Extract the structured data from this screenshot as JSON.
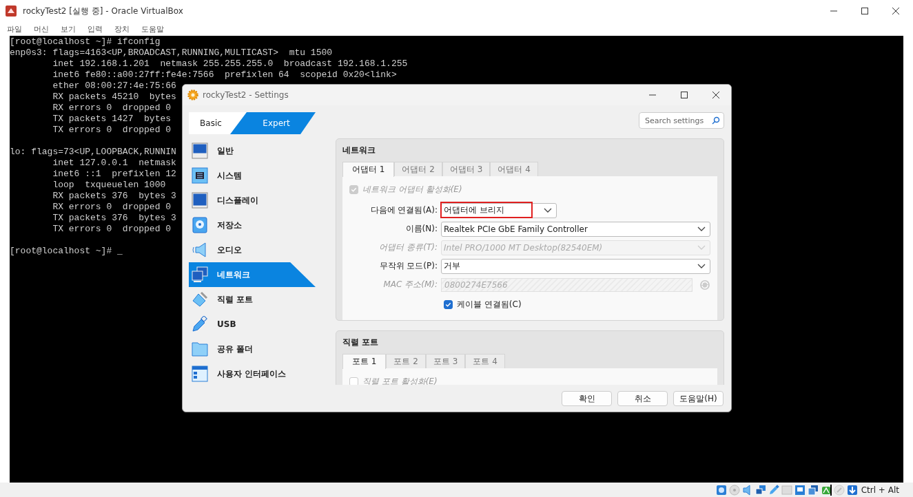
{
  "window": {
    "title": "rockyTest2 [실행 중] - Oracle VirtualBox"
  },
  "menu": [
    "파일",
    "머신",
    "보기",
    "입력",
    "장치",
    "도움말"
  ],
  "terminal": {
    "blocks": [
      [
        "[root@localhost ~]# ifconfig",
        "enp0s3: flags=4163<UP,BROADCAST,RUNNING,MULTICAST>  mtu 1500",
        "        inet 192.168.1.201  netmask 255.255.255.0  broadcast 192.168.1.255",
        "        inet6 fe80::a00:27ff:fe4e:7566  prefixlen 64  scopeid 0x20<link>",
        "        ether 08:00:27:4e:75:66",
        "        RX packets 45210  bytes",
        "        RX errors 0  dropped 0",
        "        TX packets 1427  bytes",
        "        TX errors 0  dropped 0"
      ],
      [
        "lo: flags=73<UP,LOOPBACK,RUNNIN",
        "        inet 127.0.0.1  netmask",
        "        inet6 ::1  prefixlen 12",
        "        loop  txqueuelen 1000",
        "        RX packets 376  bytes 3",
        "        RX errors 0  dropped 0",
        "        TX packets 376  bytes 3",
        "        TX errors 0  dropped 0"
      ],
      [
        "[root@localhost ~]# _"
      ]
    ]
  },
  "status_bar": {
    "keys": "Ctrl + Alt"
  },
  "dialog": {
    "title": "rockyTest2 - Settings",
    "modes": [
      {
        "label": "Basic",
        "selected": false
      },
      {
        "label": "Expert",
        "selected": true
      }
    ],
    "search": {
      "placeholder": "Search settings"
    },
    "sidebar": [
      {
        "label": "일반",
        "selected": false
      },
      {
        "label": "시스템",
        "selected": false
      },
      {
        "label": "디스플레이",
        "selected": false
      },
      {
        "label": "저장소",
        "selected": false
      },
      {
        "label": "오디오",
        "selected": false
      },
      {
        "label": "네트워크",
        "selected": true
      },
      {
        "label": "직렬 포트",
        "selected": false
      },
      {
        "label": "USB",
        "selected": false
      },
      {
        "label": "공유 폴더",
        "selected": false
      },
      {
        "label": "사용자 인터페이스",
        "selected": false
      }
    ],
    "sections": [
      {
        "title": "네트워크",
        "tabs": [
          {
            "label": "어댑터 1",
            "selected": true
          },
          {
            "label": "어댑터 2",
            "selected": false
          },
          {
            "label": "어댑터 3",
            "selected": false
          },
          {
            "label": "어댑터 4",
            "selected": false
          }
        ],
        "enable": {
          "label": "네트워크 어댑터 활성화(E)",
          "checked": true,
          "disabled": true
        },
        "fields": [
          {
            "label": "다음에 연결됨(A):",
            "value": "어댑터에 브리지",
            "kind": "select",
            "disabled": false,
            "highlighted": true
          },
          {
            "label": "이름(N):",
            "value": "Realtek PCIe GbE Family Controller",
            "kind": "select",
            "disabled": false,
            "highlighted": false
          },
          {
            "label": "어댑터 종류(T):",
            "value": "Intel PRO/1000 MT Desktop(82540EM)",
            "kind": "select",
            "disabled": true,
            "highlighted": false
          },
          {
            "label": "무작위 모드(P):",
            "value": "거부",
            "kind": "select",
            "disabled": false,
            "highlighted": false
          },
          {
            "label": "MAC 주소(M):",
            "value": "0800274E7566",
            "kind": "text",
            "disabled": true,
            "highlighted": false
          }
        ],
        "cable": {
          "label": "케이블 연결됨(C)",
          "checked": true
        }
      },
      {
        "title": "직렬 포트",
        "tabs": [
          {
            "label": "포트 1",
            "selected": true
          },
          {
            "label": "포트 2",
            "selected": false
          },
          {
            "label": "포트 3",
            "selected": false
          },
          {
            "label": "포트 4",
            "selected": false
          }
        ],
        "enable": {
          "label": "직렬 포트 활성화(E)",
          "checked": false,
          "disabled": true
        }
      }
    ],
    "buttons": [
      "확인",
      "취소",
      "도움말(H)"
    ]
  }
}
